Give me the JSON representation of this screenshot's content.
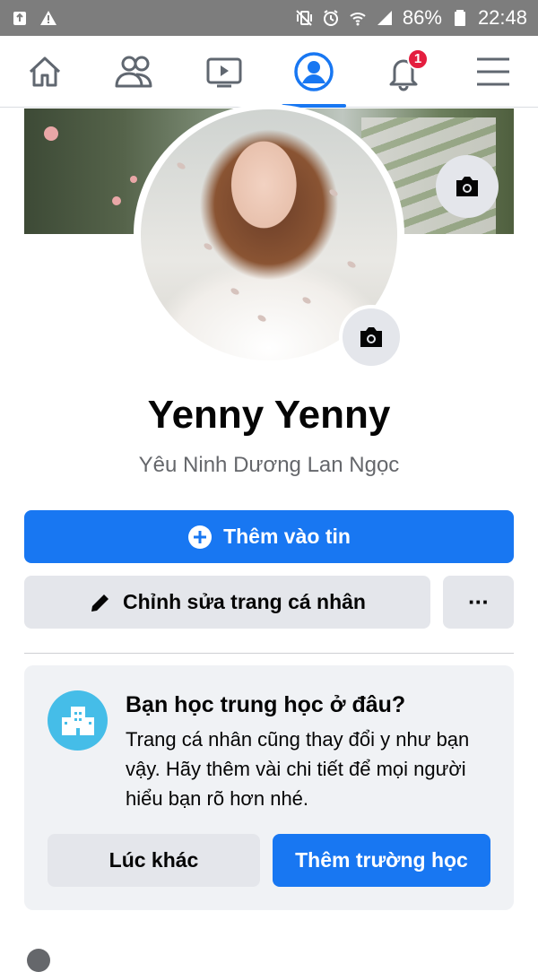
{
  "status_bar": {
    "battery": "86%",
    "time": "22:48",
    "icons": [
      "recycle-icon",
      "warning-icon",
      "mute-vibrate-icon",
      "alarm-icon",
      "wifi-icon",
      "signal-icon",
      "battery-icon"
    ]
  },
  "nav": {
    "items": [
      {
        "name": "home",
        "icon": "home-icon"
      },
      {
        "name": "friends",
        "icon": "friends-icon"
      },
      {
        "name": "watch",
        "icon": "video-icon"
      },
      {
        "name": "profile",
        "icon": "profile-icon",
        "active": true
      },
      {
        "name": "notifications",
        "icon": "bell-icon",
        "badge": "1"
      },
      {
        "name": "menu",
        "icon": "hamburger-icon"
      }
    ]
  },
  "profile": {
    "name": "Yenny Yenny",
    "subtitle": "Yêu Ninh Dương Lan Ngọc"
  },
  "actions": {
    "add_story": "Thêm vào tin",
    "edit_profile": "Chỉnh sửa trang cá nhân",
    "more": "···"
  },
  "card": {
    "title": "Bạn học trung học ở đâu?",
    "text": "Trang cá nhân cũng thay đổi y như bạn vậy. Hãy thêm vài chi tiết để mọi người hiểu bạn rõ hơn nhé.",
    "later_label": "Lúc khác",
    "add_school_label": "Thêm trường học"
  },
  "colors": {
    "accent": "#1877f2",
    "badge": "#e41e3f",
    "secondary_bg": "#e4e6eb",
    "card_bg": "#f0f2f5",
    "school_icon_bg": "#45bde8"
  }
}
